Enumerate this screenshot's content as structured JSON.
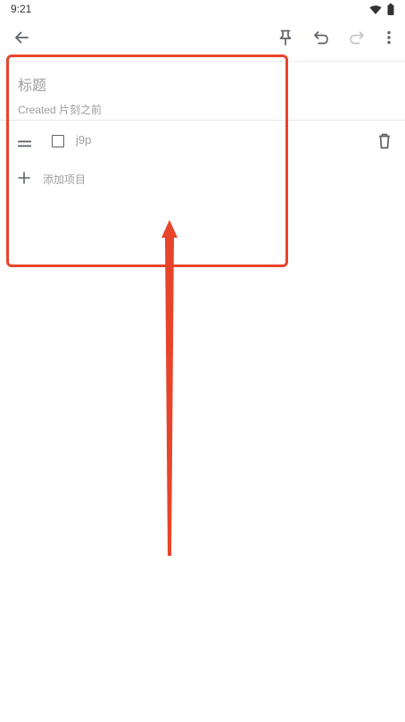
{
  "status_bar": {
    "time": "9:21"
  },
  "note": {
    "title_placeholder": "标题",
    "created_label": "Created 片刻之前",
    "items": [
      {
        "text": "j9p",
        "checked": false
      }
    ],
    "add_item_label": "添加项目"
  },
  "icons": {
    "back": "arrow-back-icon",
    "pin": "pin-icon",
    "undo": "undo-icon",
    "redo": "redo-icon",
    "more": "more-vert-icon",
    "drag": "drag-handle-icon",
    "delete": "trash-icon",
    "add": "plus-icon",
    "wifi": "wifi-icon",
    "battery": "battery-icon"
  },
  "colors": {
    "annotation": "#e8442b",
    "hint_text": "#9e9e9e",
    "icon": "#5f6368"
  }
}
